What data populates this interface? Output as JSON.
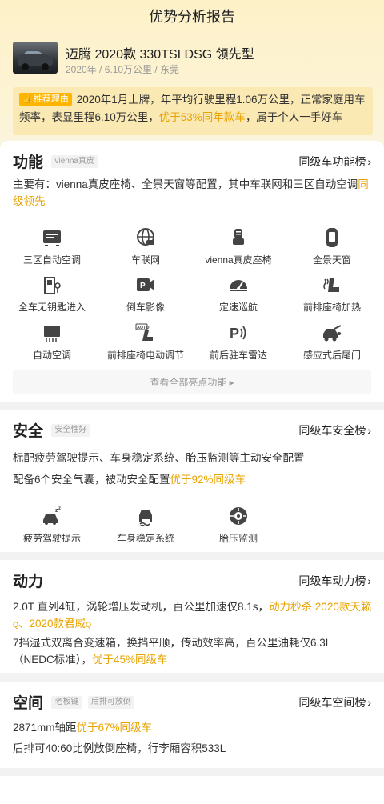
{
  "header": {
    "title": "优势分析报告"
  },
  "car": {
    "title": "迈腾 2020款 330TSI DSG 领先型",
    "sub": "2020年 / 6.10万公里 / 东莞"
  },
  "reason": {
    "badge": "推荐理由",
    "text_a": "2020年1月上牌，年平均行驶里程1.06万公里，正常家庭用车频率，表显里程6.10万公里，",
    "highlight": "优于53%同年款车",
    "text_b": "，属于个人一手好车"
  },
  "function": {
    "title": "功能",
    "tag": "vienna真皮",
    "rank_label": "同级车功能榜",
    "desc_a": "主要有：vienna真皮座椅、全景天窗等配置，其中车联网和三区自动空调",
    "desc_hl": "同级领先",
    "items": [
      {
        "label": "三区自动空调",
        "icon": "ac-panel-icon"
      },
      {
        "label": "车联网",
        "icon": "globe-car-icon"
      },
      {
        "label": "vienna真皮座椅",
        "icon": "seat-icon"
      },
      {
        "label": "全景天窗",
        "icon": "sunroof-icon"
      },
      {
        "label": "全车无钥匙进入",
        "icon": "door-key-icon"
      },
      {
        "label": "倒车影像",
        "icon": "reverse-camera-icon"
      },
      {
        "label": "定速巡航",
        "icon": "cruise-gauge-icon"
      },
      {
        "label": "前排座椅加热",
        "icon": "seat-heat-icon"
      },
      {
        "label": "自动空调",
        "icon": "auto-ac-icon"
      },
      {
        "label": "前排座椅电动调节",
        "icon": "auto-seat-icon"
      },
      {
        "label": "前后驻车雷达",
        "icon": "parking-radar-icon"
      },
      {
        "label": "感应式后尾门",
        "icon": "tailgate-icon"
      }
    ],
    "more_label": "查看全部亮点功能 ▸"
  },
  "safety": {
    "title": "安全",
    "tag": "安全性好",
    "rank_label": "同级车安全榜",
    "line1": "标配疲劳驾驶提示、车身稳定系统、胎压监测等主动安全配置",
    "line2_a": "配备6个安全气囊，被动安全配置",
    "line2_hl": "优于92%同级车",
    "items": [
      {
        "label": "疲劳驾驶提示",
        "icon": "fatigue-icon"
      },
      {
        "label": "车身稳定系统",
        "icon": "stability-icon"
      },
      {
        "label": "胎压监测",
        "icon": "tire-pressure-icon"
      }
    ]
  },
  "power": {
    "title": "动力",
    "rank_label": "同级车动力榜",
    "line1_a": "2.0T 直列4缸，涡轮增压发动机，百公里加速仅8.1s，",
    "line1_hl": "动力秒杀 2020款天籁",
    "line1_sep": "、",
    "line1_hl2": "2020款君威",
    "line2_a": "7挡湿式双离合变速箱，换挡平顺，传动效率高，百公里油耗仅6.3L（NEDC标准），",
    "line2_hl": "优于45%同级车"
  },
  "space": {
    "title": "空间",
    "tags": [
      "老板键",
      "后排可放倒"
    ],
    "rank_label": "同级车空间榜",
    "line1_a": "2871mm轴距",
    "line1_hl": "优于67%同级车",
    "line2": "后排可40:60比例放倒座椅，行李厢容积533L"
  },
  "colors": {
    "accent": "#e8a300",
    "badge": "#ffb400",
    "icon": "#444444"
  }
}
